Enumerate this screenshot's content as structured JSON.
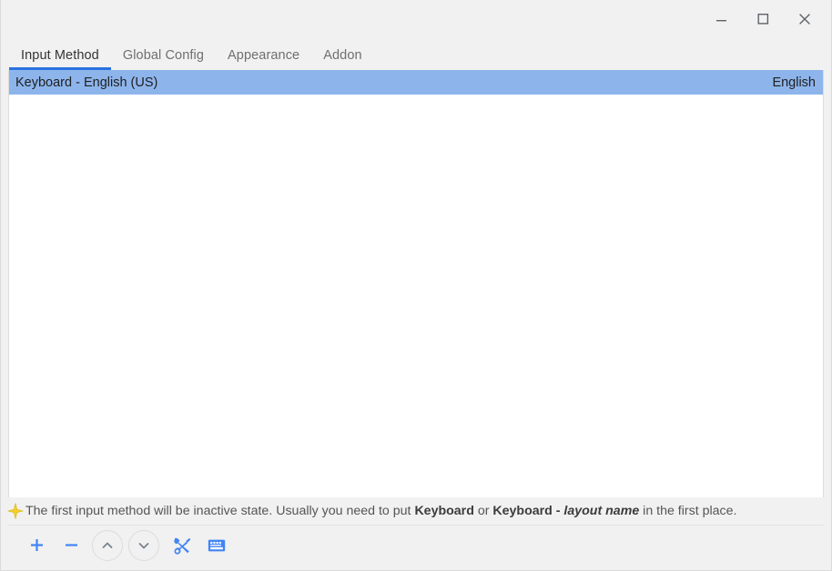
{
  "window": {
    "controls": [
      {
        "name": "minimize",
        "label": "Minimize",
        "glyph": "minimize-icon"
      },
      {
        "name": "maximize",
        "label": "Maximize",
        "glyph": "maximize-icon"
      },
      {
        "name": "close",
        "label": "Close",
        "glyph": "close-icon"
      }
    ],
    "accent_color": "#2a72e0",
    "titlebar_color": "#f1f1f1",
    "selection_color": "#8db5ec"
  },
  "tabs": [
    {
      "label": "Input Method",
      "active": true
    },
    {
      "label": "Global Config",
      "active": false
    },
    {
      "label": "Appearance",
      "active": false
    },
    {
      "label": "Addon",
      "active": false
    }
  ],
  "input_methods": [
    {
      "name": "Keyboard - English (US)",
      "language": "English",
      "selected": true
    }
  ],
  "status": {
    "icon": "sparkle-star-icon",
    "text_part_1": "The first input method will be inactive state. Usually you need to put ",
    "bold_1": "Keyboard",
    "text_part_2": " or ",
    "bold_2": "Keyboard - ",
    "bold_italic": "layout name",
    "text_part_3": " in the first place."
  },
  "toolbar": {
    "buttons": [
      {
        "name": "add-input-method",
        "label": "+",
        "icon": "plus-icon",
        "color": "#4285f4"
      },
      {
        "name": "remove-input-method",
        "label": "−",
        "icon": "minus-icon",
        "color": "#4285f4"
      },
      {
        "name": "move-up",
        "label": "Move Up",
        "icon": "chevron-up-icon",
        "color": "#78808a"
      },
      {
        "name": "move-down",
        "label": "Move Down",
        "icon": "chevron-down-icon",
        "color": "#78808a"
      },
      {
        "name": "configure-input-method",
        "label": "Configure",
        "icon": "tools-icon",
        "color": "#4285f4"
      },
      {
        "name": "virtual-keyboard",
        "label": "Virtual Keyboard",
        "icon": "keyboard-icon",
        "color": "#4285f4"
      }
    ]
  }
}
